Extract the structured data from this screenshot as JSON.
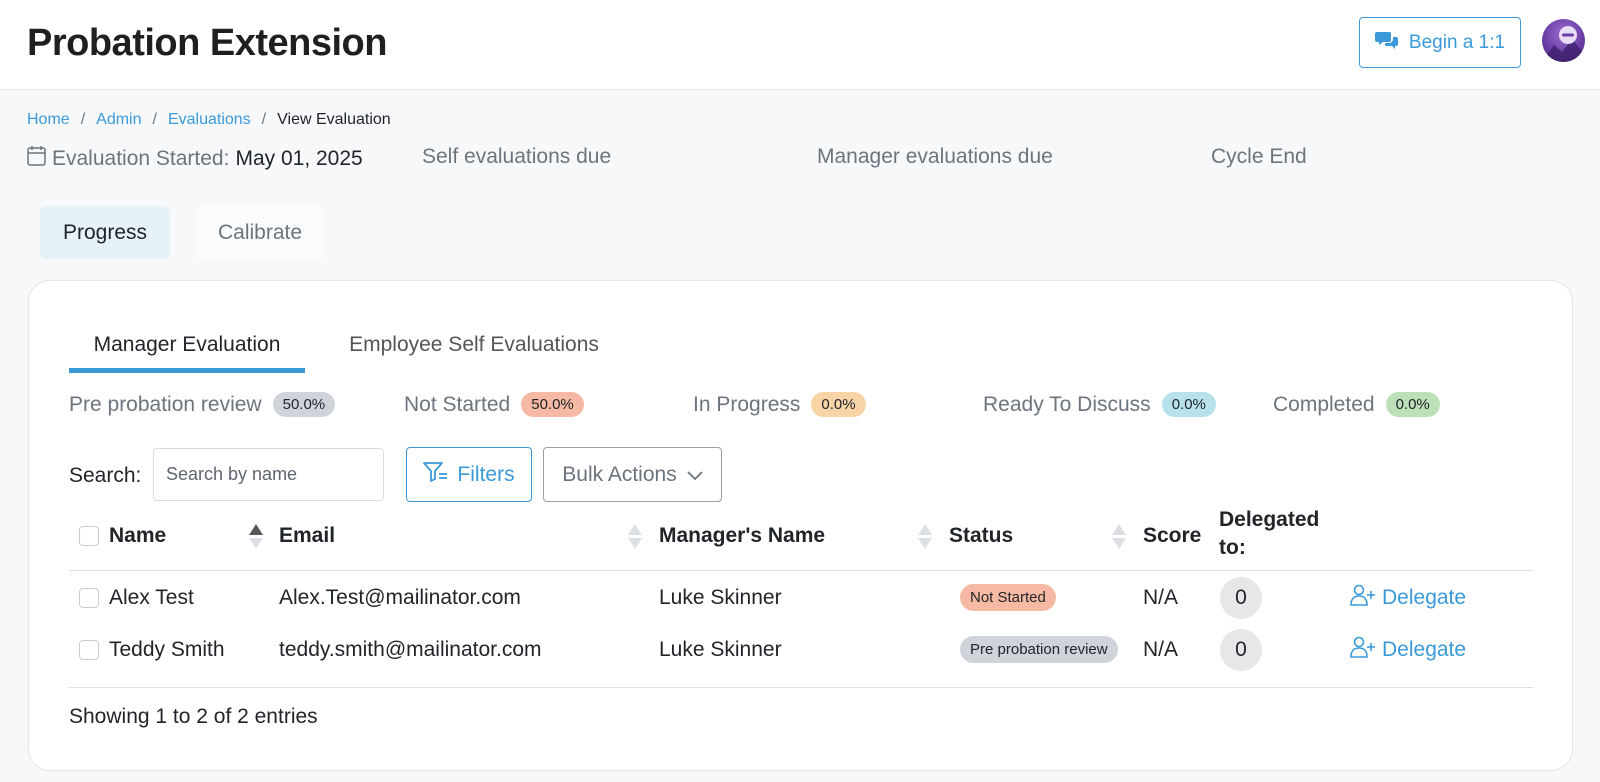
{
  "header": {
    "title": "Probation Extension",
    "begin_label": "Begin a 1:1"
  },
  "breadcrumb": {
    "items": [
      "Home",
      "Admin",
      "Evaluations"
    ],
    "separator": "/",
    "current": "View Evaluation"
  },
  "meta": {
    "started_label": "Evaluation Started:",
    "started_value": "May 01, 2025",
    "self_due": "Self evaluations due",
    "manager_due": "Manager evaluations due",
    "cycle_end": "Cycle End"
  },
  "main_tabs": {
    "progress": "Progress",
    "calibrate": "Calibrate"
  },
  "eval_tabs": {
    "manager": "Manager Evaluation",
    "self": "Employee Self Evaluations"
  },
  "stats": [
    {
      "label": "Pre probation review",
      "value": "50.0%",
      "color": "#cfd4da"
    },
    {
      "label": "Not Started",
      "value": "50.0%",
      "color": "#f6b9a3"
    },
    {
      "label": "In Progress",
      "value": "0.0%",
      "color": "#f8d3a6"
    },
    {
      "label": "Ready To Discuss",
      "value": "0.0%",
      "color": "#b7e2ec"
    },
    {
      "label": "Completed",
      "value": "0.0%",
      "color": "#bde0b9"
    }
  ],
  "toolbar": {
    "search_label": "Search:",
    "search_placeholder": "Search by name",
    "filters_label": "Filters",
    "bulk_label": "Bulk Actions"
  },
  "table": {
    "columns": {
      "name": "Name",
      "email": "Email",
      "manager": "Manager's Name",
      "status": "Status",
      "score": "Score",
      "delegated_line1": "Delegated",
      "delegated_line2": "to:"
    },
    "rows": [
      {
        "name": "Alex Test",
        "email": "Alex.Test@mailinator.com",
        "manager": "Luke Skinner",
        "status": "Not Started",
        "status_color": "#f6b9a3",
        "score": "N/A",
        "delegated": "0",
        "action": "Delegate"
      },
      {
        "name": "Teddy Smith",
        "email": "teddy.smith@mailinator.com",
        "manager": "Luke Skinner",
        "status": "Pre probation review",
        "status_color": "#cfd4da",
        "score": "N/A",
        "delegated": "0",
        "action": "Delegate"
      }
    ],
    "footer": "Showing 1 to 2 of 2 entries"
  },
  "colors": {
    "accent": "#3a9ad9"
  }
}
